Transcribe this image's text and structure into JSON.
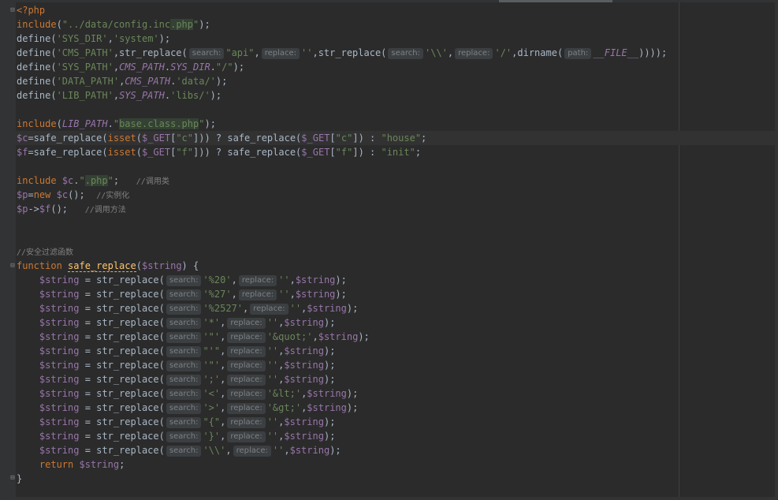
{
  "editor": {
    "lines": [
      "<?php",
      "include(\"../data/config.inc.php\");",
      "define('SYS_DIR','system');",
      "define('CMS_PATH',str_replace( search: \"api\", replace: '',str_replace( search: '\\\\', replace: '/',dirname( path: __FILE__))));",
      "define('SYS_PATH',CMS_PATH.SYS_DIR.\"/\");",
      "define('DATA_PATH',CMS_PATH.'data/');",
      "define('LIB_PATH',SYS_PATH.'libs/');",
      "",
      "include(LIB_PATH.\"base.class.php\");",
      "$c=safe_replace(isset($_GET[\"c\"])) ? safe_replace($_GET[\"c\"]) : \"house\";",
      "$f=safe_replace(isset($_GET[\"f\"])) ? safe_replace($_GET[\"f\"]) : \"init\";",
      "",
      "include $c.\".php\";   //调用类",
      "$p=new $c();  //实例化",
      "$p->$f();   //调用方法",
      "",
      "",
      "//安全过滤函数",
      "function safe_replace($string) {",
      "    $string = str_replace( search: '%20', replace: '',$string);",
      "    $string = str_replace( search: '%27', replace: '',$string);",
      "    $string = str_replace( search: '%2527', replace: '',$string);",
      "    $string = str_replace( search: '*', replace: '',$string);",
      "    $string = str_replace( search: '\"', replace: '&quot;',$string);",
      "    $string = str_replace( search: \"'\", replace: '',$string);",
      "    $string = str_replace( search: '\"', replace: '',$string);",
      "    $string = str_replace( search: ';', replace: '',$string);",
      "    $string = str_replace( search: '<', replace: '&lt;',$string);",
      "    $string = str_replace( search: '>', replace: '&gt;',$string);",
      "    $string = str_replace( search: \"{\", replace: '',$string);",
      "    $string = str_replace( search: '}', replace: '',$string);",
      "    $string = str_replace( search: '\\\\', replace: '',$string);",
      "    return $string;",
      "}"
    ],
    "current_line": 10
  },
  "colors": {
    "background": "#2b2b2b",
    "keyword": "#cc7832",
    "string": "#6a8759",
    "variable": "#9876aa",
    "function": "#ffc66d",
    "comment": "#808080",
    "text": "#a9b7c6"
  },
  "icons": [
    "fold-open-icon",
    "fold-close-icon"
  ]
}
